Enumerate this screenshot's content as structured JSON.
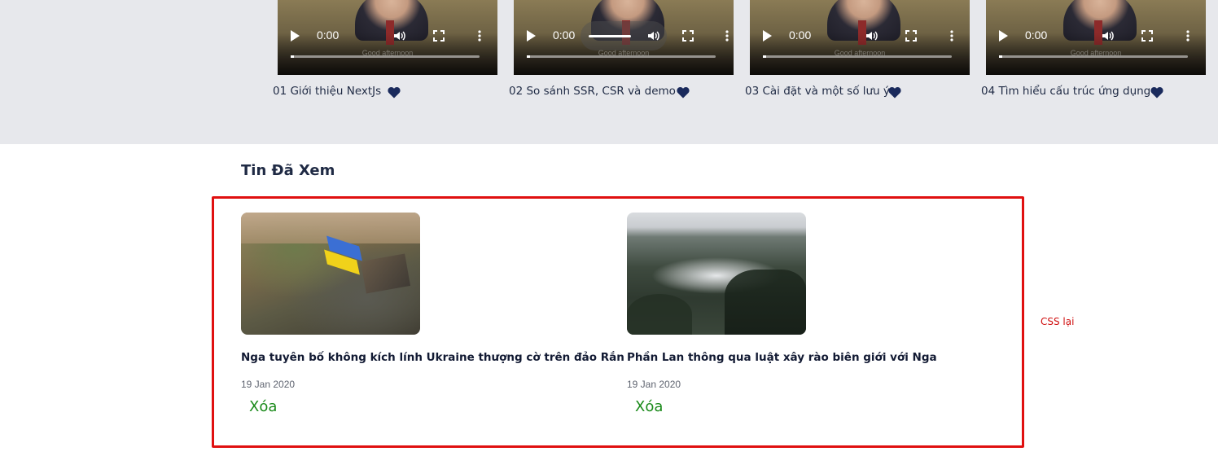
{
  "videos": [
    {
      "time": "0:00",
      "title": "01 Giới thiệu NextJs",
      "caption": "Good afternoon"
    },
    {
      "time": "0:00",
      "title": "02 So sánh SSR, CSR và demo",
      "caption": "Good afternoon"
    },
    {
      "time": "0:00",
      "title": "03 Cài đặt và một số lưu ý",
      "caption": "Good afternoon"
    },
    {
      "time": "0:00",
      "title": "04 Tìm hiểu cấu trúc ứng dụng",
      "caption": "Good afternoon"
    }
  ],
  "history": {
    "title": "Tin Đã Xem",
    "items": [
      {
        "title": "Nga tuyên bố không kích lính Ukraine thượng cờ trên đảo Rắn",
        "date": "19 Jan 2020",
        "delete_label": "Xóa"
      },
      {
        "title": "Phần Lan thông qua luật xây rào biên giới với Nga",
        "date": "19 Jan 2020",
        "delete_label": "Xóa"
      }
    ]
  },
  "note": "CSS lại",
  "colors": {
    "heart": "#1a2a5c",
    "delete": "#1a8a1a",
    "highlight_border": "#e01010",
    "note": "#d01010"
  }
}
